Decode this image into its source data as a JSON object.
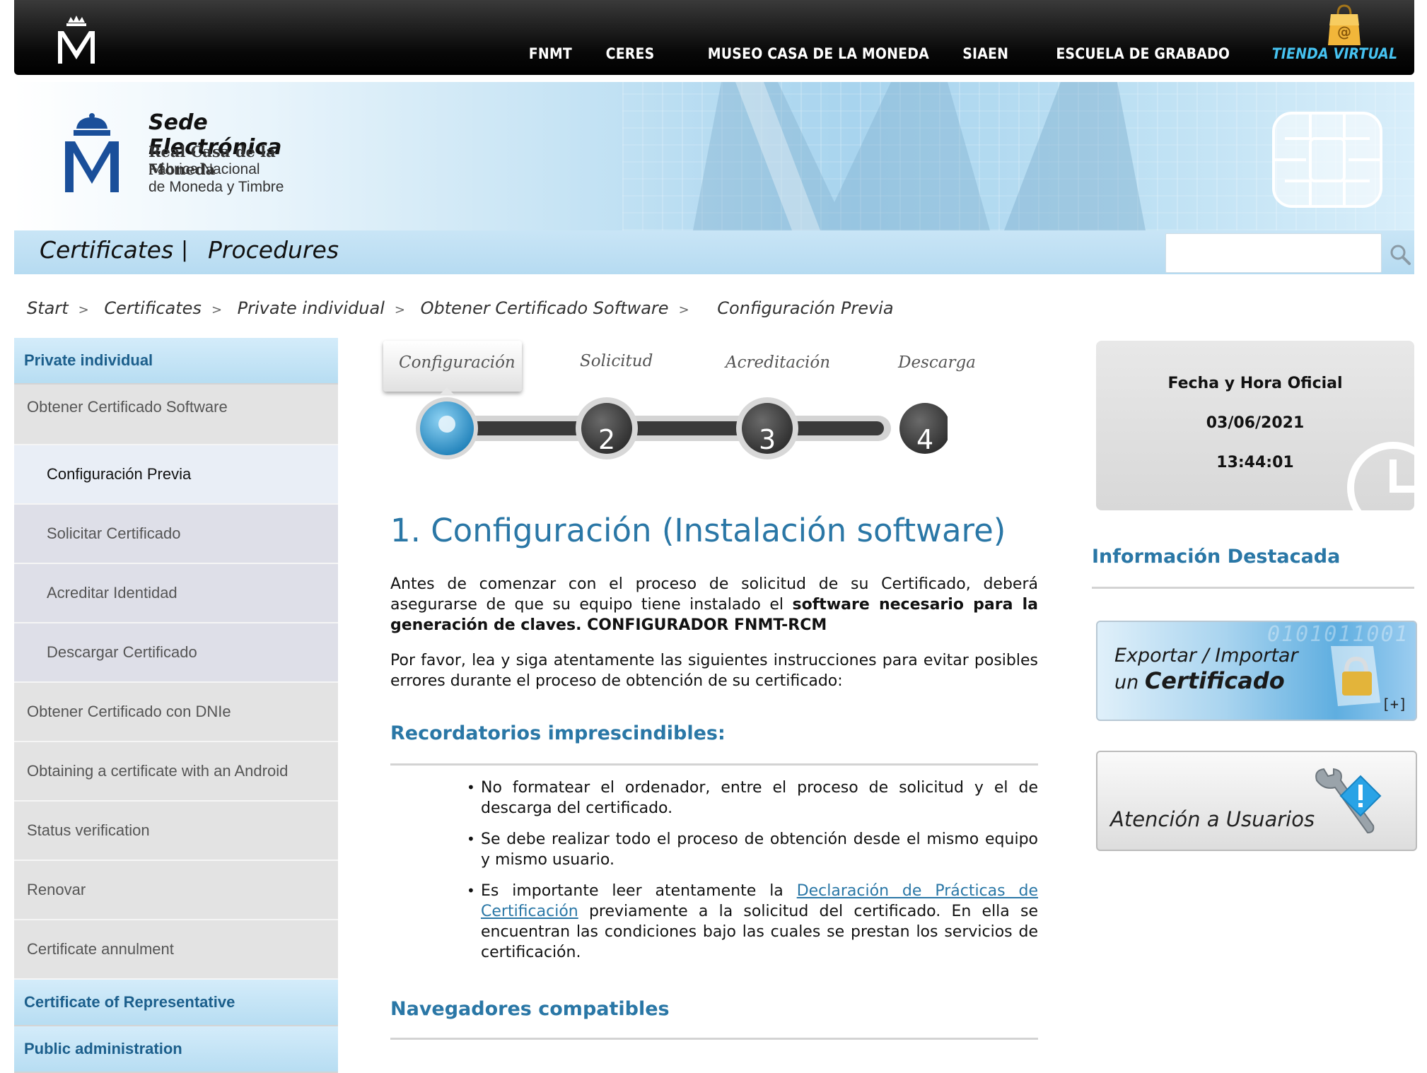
{
  "topnav": {
    "items": [
      "FNMT",
      "CERES",
      "MUSEO CASA DE LA MONEDA",
      "SIAEN",
      "ESCUELA DE GRABADO"
    ],
    "tienda": "TIENDA VIRTUAL"
  },
  "brand": {
    "sede": "Sede Electrónica",
    "line1": "Real Casa de la Moneda",
    "line2": "Fábrica Nacional",
    "line3": "de Moneda y Timbre"
  },
  "menu": {
    "certificates": "Certificates",
    "separator": "|",
    "procedures": "Procedures",
    "search_placeholder": ""
  },
  "breadcrumb": {
    "items": [
      "Start",
      "Certificates",
      "Private individual",
      "Obtener Certificado Software"
    ],
    "current": "Configuración Previa",
    "sep": ">"
  },
  "sidebar": {
    "header1": "Private individual",
    "items": [
      "Obtener Certificado Software",
      "Configuración Previa",
      "Solicitar Certificado",
      "Acreditar Identidad",
      "Descargar Certificado",
      "Obtener Certificado con DNIe",
      "Obtaining a certificate with an Android",
      "Status verification",
      "Renovar",
      "Certificate annulment"
    ],
    "header2": "Certificate of Representative",
    "header3": "Public administration"
  },
  "stepper": {
    "labels": [
      "Configuración",
      "Solicitud",
      "Acreditación",
      "Descarga"
    ],
    "numbers": [
      "2",
      "3",
      "4"
    ],
    "active_index": 0
  },
  "main": {
    "title": "1. Configuración (Instalación software)",
    "p1_a": "Antes de comenzar con el proceso de solicitud de su Certificado, deberá asegurarse de que su equipo tiene instalado el ",
    "p1_b": "software necesario para la generación de claves. CONFIGURADOR FNMT-RCM",
    "p2": "Por favor, lea y siga atentamente las siguientes instrucciones para evitar posibles errores durante el proceso de obtención de su certificado:",
    "h_recordatorios": "Recordatorios imprescindibles:",
    "bullet1": "No formatear el ordenador, entre el proceso de solicitud y el de descarga del certificado.",
    "bullet2": "Se debe realizar todo el proceso de obtención desde el mismo equipo y mismo usuario.",
    "bullet3_a": "Es importante leer atentamente la ",
    "bullet3_link": "Declaración de Prácticas de Certificación",
    "bullet3_b": " previamente a la solicitud del certificado. En ella se encuentran las condiciones bajo las cuales se prestan los servicios de certificación.",
    "h_navegadores": "Navegadores compatibles"
  },
  "right": {
    "clock_title": "Fecha y Hora Oficial",
    "date": "03/06/2021",
    "time": "13:44:01",
    "info_title": "Información Destacada",
    "promo1_l1": "Exportar / Importar",
    "promo1_l2a": "un ",
    "promo1_l2b": "Certificado",
    "promo1_plus": "[+]",
    "promo2": "Atención a Usuarios"
  },
  "colors": {
    "accent_blue": "#2a77a6",
    "sidebar_head": "#1c5f8c",
    "tienda": "#46c2f0"
  }
}
